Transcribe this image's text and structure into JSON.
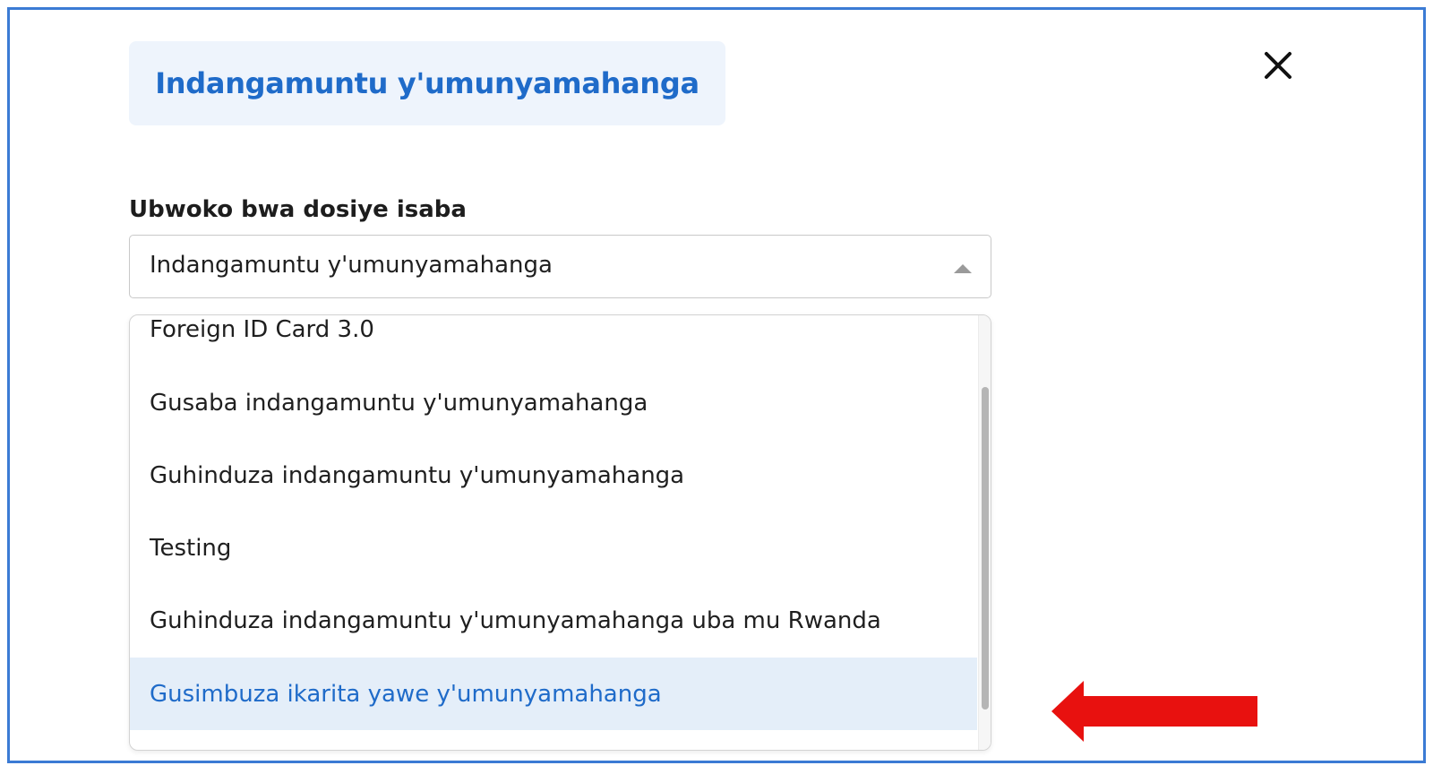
{
  "dialog": {
    "title": "Indangamuntu y'umunyamahanga",
    "close_icon": "close-icon"
  },
  "field": {
    "label": "Ubwoko bwa dosiye isaba",
    "selected_value": "Indangamuntu y'umunyamahanga"
  },
  "dropdown": {
    "options": [
      {
        "label": "Foreign ID Card 3.0"
      },
      {
        "label": "Gusaba indangamuntu y'umunyamahanga"
      },
      {
        "label": "Guhinduza indangamuntu y'umunyamahanga"
      },
      {
        "label": "Testing"
      },
      {
        "label": "Guhinduza indangamuntu y'umunyamahanga uba mu Rwanda"
      },
      {
        "label": "Gusimbuza ikarita yawe y'umunyamahanga"
      }
    ],
    "highlighted_option": "Gusimbuza ikarita yawe y'umunyamahanga"
  },
  "annotation": {
    "icon": "red-arrow-icon",
    "color": "#e8110f"
  },
  "colors": {
    "frame_border": "#3b7bd4",
    "accent_text": "#1f6bc9",
    "title_bg": "#eef4fc",
    "highlight_bg": "#e4eef9"
  }
}
